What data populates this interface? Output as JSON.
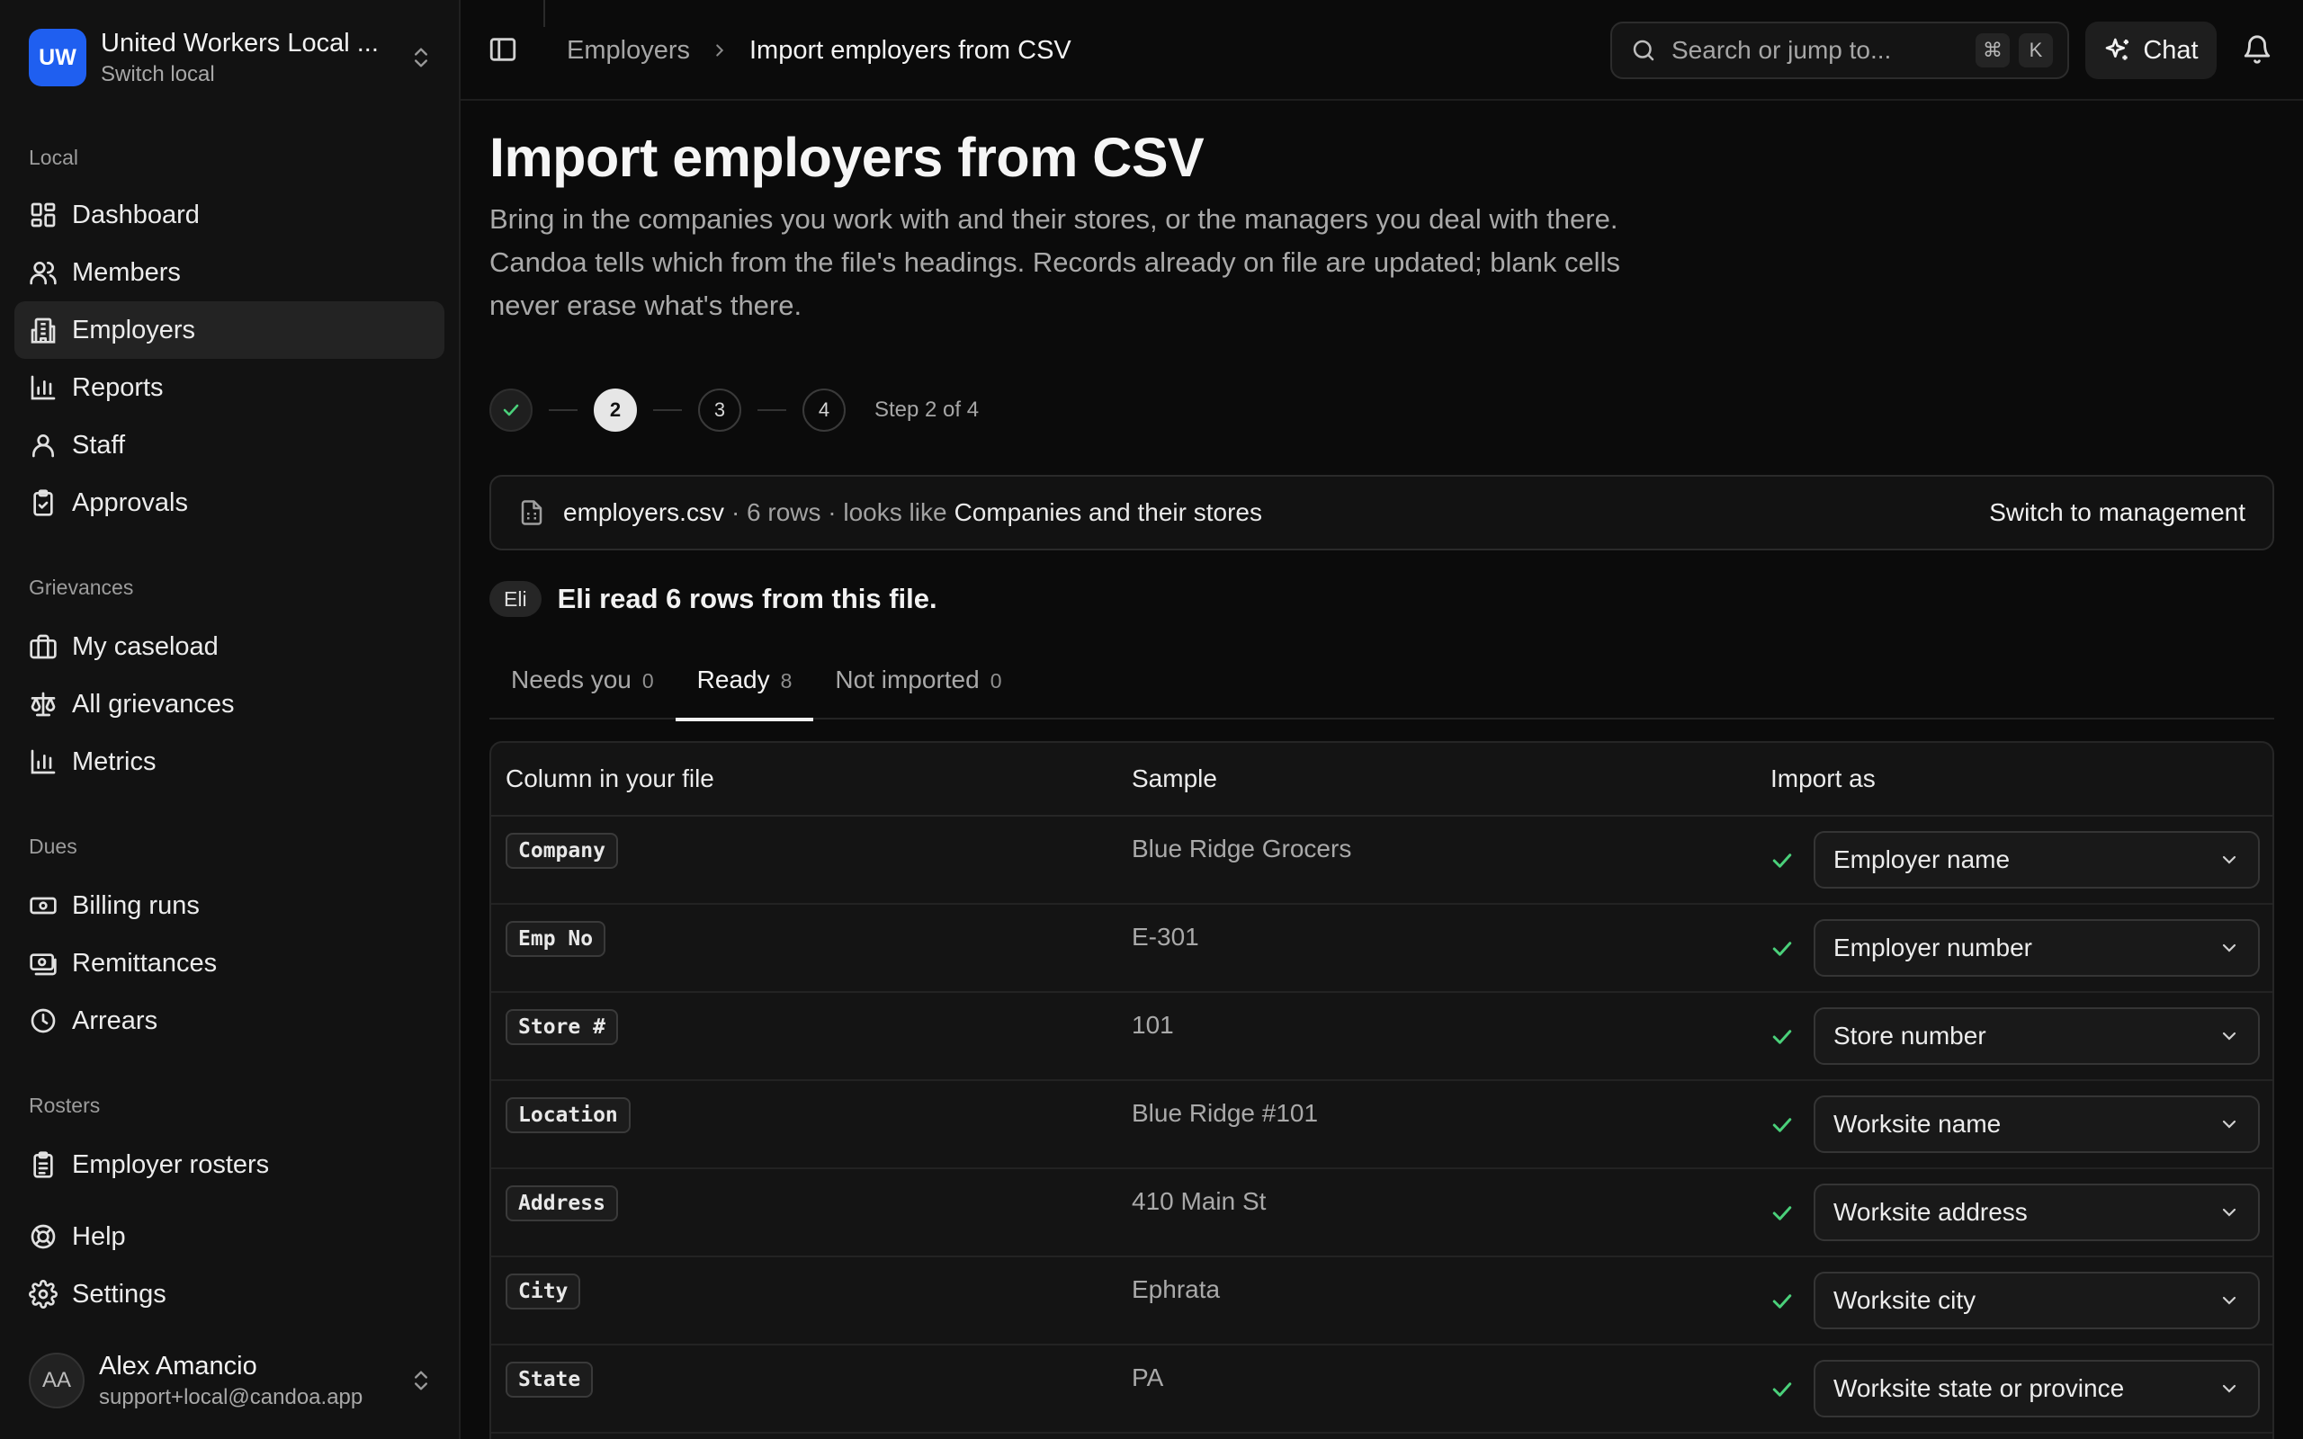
{
  "org": {
    "initials": "UW",
    "name": "United Workers Local ...",
    "sub": "Switch local"
  },
  "sidebar": {
    "sections": {
      "local": "Local",
      "grievances": "Grievances",
      "dues": "Dues",
      "rosters": "Rosters"
    },
    "items": [
      {
        "label": "Dashboard",
        "icon": "dashboard-icon"
      },
      {
        "label": "Members",
        "icon": "members-icon"
      },
      {
        "label": "Employers",
        "icon": "building-icon",
        "active": true
      },
      {
        "label": "Reports",
        "icon": "bar-chart-icon"
      },
      {
        "label": "Staff",
        "icon": "user-icon"
      },
      {
        "label": "Approvals",
        "icon": "clipboard-check-icon"
      },
      {
        "label": "My caseload",
        "icon": "briefcase-icon"
      },
      {
        "label": "All grievances",
        "icon": "scale-icon"
      },
      {
        "label": "Metrics",
        "icon": "bar-chart-icon"
      },
      {
        "label": "Billing runs",
        "icon": "banknote-icon"
      },
      {
        "label": "Remittances",
        "icon": "payment-icon"
      },
      {
        "label": "Arrears",
        "icon": "clock-icon"
      },
      {
        "label": "Employer rosters",
        "icon": "clipboard-list-icon"
      },
      {
        "label": "Help",
        "icon": "lifebuoy-icon"
      },
      {
        "label": "Settings",
        "icon": "gear-icon"
      }
    ]
  },
  "user": {
    "initials": "AA",
    "name": "Alex Amancio",
    "email": "support+local@candoa.app"
  },
  "topbar": {
    "breadcrumb_parent": "Employers",
    "breadcrumb_current": "Import employers from CSV",
    "search_placeholder": "Search or jump to...",
    "kbd_cmd": "⌘",
    "kbd_k": "K",
    "chat_label": "Chat"
  },
  "page": {
    "title": "Import employers from CSV",
    "description": "Bring in the companies you work with and their stores, or the managers you deal with there. Candoa tells which from the file's headings. Records already on file are updated; blank cells never erase what's there."
  },
  "stepper": {
    "steps": [
      "1",
      "2",
      "3",
      "4"
    ],
    "current": 2,
    "label": "Step 2 of 4"
  },
  "file": {
    "name": "employers.csv",
    "meta": "· 6 rows · looks like",
    "kind": "Companies and their stores",
    "switch_label": "Switch to management"
  },
  "eli": {
    "badge": "Eli",
    "message": "Eli read 6 rows from this file."
  },
  "tabs": [
    {
      "label": "Needs you",
      "count": "0"
    },
    {
      "label": "Ready",
      "count": "8",
      "active": true
    },
    {
      "label": "Not imported",
      "count": "0"
    }
  ],
  "table": {
    "headers": {
      "column": "Column in your file",
      "sample": "Sample",
      "import_as": "Import as"
    },
    "rows": [
      {
        "column": "Company",
        "sample": "Blue Ridge Grocers",
        "import_as": "Employer name"
      },
      {
        "column": "Emp No",
        "sample": "E-301",
        "import_as": "Employer number"
      },
      {
        "column": "Store #",
        "sample": "101",
        "import_as": "Store number"
      },
      {
        "column": "Location",
        "sample": "Blue Ridge #101",
        "import_as": "Worksite name"
      },
      {
        "column": "Address",
        "sample": "410 Main St",
        "import_as": "Worksite address"
      },
      {
        "column": "City",
        "sample": "Ephrata",
        "import_as": "Worksite city"
      },
      {
        "column": "State",
        "sample": "PA",
        "import_as": "Worksite state or province"
      }
    ]
  },
  "colors": {
    "accent": "#1f5ff0",
    "success": "#4ad07a",
    "background": "#0b0b0b",
    "sidebar": "#121212"
  }
}
